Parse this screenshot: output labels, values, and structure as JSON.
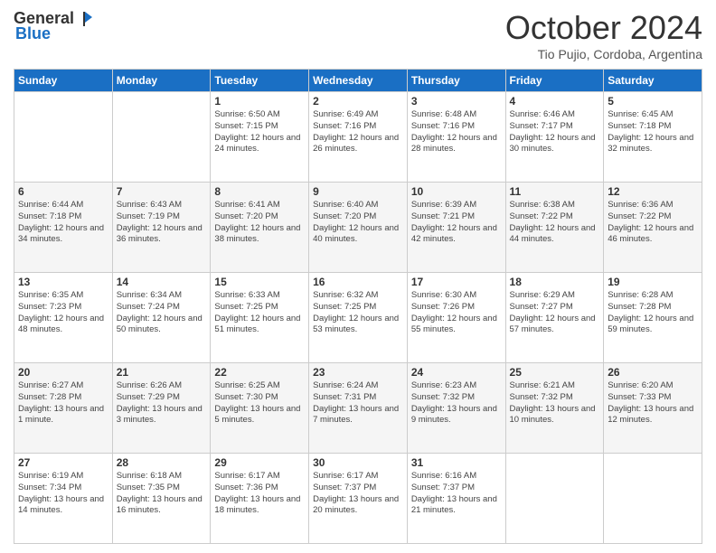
{
  "logo": {
    "general": "General",
    "blue": "Blue"
  },
  "header": {
    "month": "October 2024",
    "location": "Tio Pujio, Cordoba, Argentina"
  },
  "weekdays": [
    "Sunday",
    "Monday",
    "Tuesday",
    "Wednesday",
    "Thursday",
    "Friday",
    "Saturday"
  ],
  "weeks": [
    [
      {
        "day": "",
        "info": ""
      },
      {
        "day": "",
        "info": ""
      },
      {
        "day": "1",
        "info": "Sunrise: 6:50 AM\nSunset: 7:15 PM\nDaylight: 12 hours and 24 minutes."
      },
      {
        "day": "2",
        "info": "Sunrise: 6:49 AM\nSunset: 7:16 PM\nDaylight: 12 hours and 26 minutes."
      },
      {
        "day": "3",
        "info": "Sunrise: 6:48 AM\nSunset: 7:16 PM\nDaylight: 12 hours and 28 minutes."
      },
      {
        "day": "4",
        "info": "Sunrise: 6:46 AM\nSunset: 7:17 PM\nDaylight: 12 hours and 30 minutes."
      },
      {
        "day": "5",
        "info": "Sunrise: 6:45 AM\nSunset: 7:18 PM\nDaylight: 12 hours and 32 minutes."
      }
    ],
    [
      {
        "day": "6",
        "info": "Sunrise: 6:44 AM\nSunset: 7:18 PM\nDaylight: 12 hours and 34 minutes."
      },
      {
        "day": "7",
        "info": "Sunrise: 6:43 AM\nSunset: 7:19 PM\nDaylight: 12 hours and 36 minutes."
      },
      {
        "day": "8",
        "info": "Sunrise: 6:41 AM\nSunset: 7:20 PM\nDaylight: 12 hours and 38 minutes."
      },
      {
        "day": "9",
        "info": "Sunrise: 6:40 AM\nSunset: 7:20 PM\nDaylight: 12 hours and 40 minutes."
      },
      {
        "day": "10",
        "info": "Sunrise: 6:39 AM\nSunset: 7:21 PM\nDaylight: 12 hours and 42 minutes."
      },
      {
        "day": "11",
        "info": "Sunrise: 6:38 AM\nSunset: 7:22 PM\nDaylight: 12 hours and 44 minutes."
      },
      {
        "day": "12",
        "info": "Sunrise: 6:36 AM\nSunset: 7:22 PM\nDaylight: 12 hours and 46 minutes."
      }
    ],
    [
      {
        "day": "13",
        "info": "Sunrise: 6:35 AM\nSunset: 7:23 PM\nDaylight: 12 hours and 48 minutes."
      },
      {
        "day": "14",
        "info": "Sunrise: 6:34 AM\nSunset: 7:24 PM\nDaylight: 12 hours and 50 minutes."
      },
      {
        "day": "15",
        "info": "Sunrise: 6:33 AM\nSunset: 7:25 PM\nDaylight: 12 hours and 51 minutes."
      },
      {
        "day": "16",
        "info": "Sunrise: 6:32 AM\nSunset: 7:25 PM\nDaylight: 12 hours and 53 minutes."
      },
      {
        "day": "17",
        "info": "Sunrise: 6:30 AM\nSunset: 7:26 PM\nDaylight: 12 hours and 55 minutes."
      },
      {
        "day": "18",
        "info": "Sunrise: 6:29 AM\nSunset: 7:27 PM\nDaylight: 12 hours and 57 minutes."
      },
      {
        "day": "19",
        "info": "Sunrise: 6:28 AM\nSunset: 7:28 PM\nDaylight: 12 hours and 59 minutes."
      }
    ],
    [
      {
        "day": "20",
        "info": "Sunrise: 6:27 AM\nSunset: 7:28 PM\nDaylight: 13 hours and 1 minute."
      },
      {
        "day": "21",
        "info": "Sunrise: 6:26 AM\nSunset: 7:29 PM\nDaylight: 13 hours and 3 minutes."
      },
      {
        "day": "22",
        "info": "Sunrise: 6:25 AM\nSunset: 7:30 PM\nDaylight: 13 hours and 5 minutes."
      },
      {
        "day": "23",
        "info": "Sunrise: 6:24 AM\nSunset: 7:31 PM\nDaylight: 13 hours and 7 minutes."
      },
      {
        "day": "24",
        "info": "Sunrise: 6:23 AM\nSunset: 7:32 PM\nDaylight: 13 hours and 9 minutes."
      },
      {
        "day": "25",
        "info": "Sunrise: 6:21 AM\nSunset: 7:32 PM\nDaylight: 13 hours and 10 minutes."
      },
      {
        "day": "26",
        "info": "Sunrise: 6:20 AM\nSunset: 7:33 PM\nDaylight: 13 hours and 12 minutes."
      }
    ],
    [
      {
        "day": "27",
        "info": "Sunrise: 6:19 AM\nSunset: 7:34 PM\nDaylight: 13 hours and 14 minutes."
      },
      {
        "day": "28",
        "info": "Sunrise: 6:18 AM\nSunset: 7:35 PM\nDaylight: 13 hours and 16 minutes."
      },
      {
        "day": "29",
        "info": "Sunrise: 6:17 AM\nSunset: 7:36 PM\nDaylight: 13 hours and 18 minutes."
      },
      {
        "day": "30",
        "info": "Sunrise: 6:17 AM\nSunset: 7:37 PM\nDaylight: 13 hours and 20 minutes."
      },
      {
        "day": "31",
        "info": "Sunrise: 6:16 AM\nSunset: 7:37 PM\nDaylight: 13 hours and 21 minutes."
      },
      {
        "day": "",
        "info": ""
      },
      {
        "day": "",
        "info": ""
      }
    ]
  ]
}
